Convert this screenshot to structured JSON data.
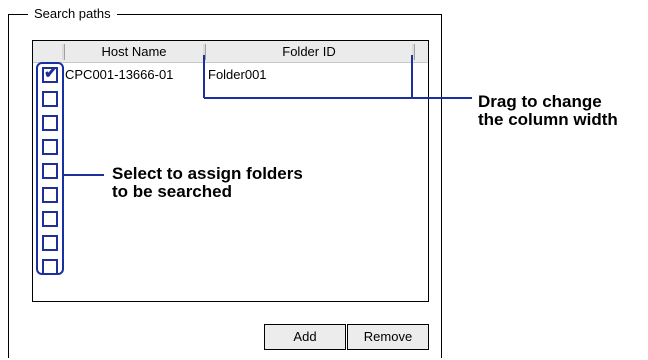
{
  "groupbox": {
    "title": "Search paths"
  },
  "table": {
    "columns": [
      "",
      "Host Name",
      "Folder ID"
    ],
    "rows": [
      {
        "checked": true,
        "host": "CPC001-13666-01",
        "folder": "Folder001"
      },
      {
        "checked": false,
        "host": "",
        "folder": ""
      },
      {
        "checked": false,
        "host": "",
        "folder": ""
      },
      {
        "checked": false,
        "host": "",
        "folder": ""
      },
      {
        "checked": false,
        "host": "",
        "folder": ""
      },
      {
        "checked": false,
        "host": "",
        "folder": ""
      },
      {
        "checked": false,
        "host": "",
        "folder": ""
      },
      {
        "checked": false,
        "host": "",
        "folder": ""
      },
      {
        "checked": false,
        "host": "",
        "folder": ""
      }
    ]
  },
  "buttons": {
    "add": "Add",
    "remove": "Remove"
  },
  "annotations": {
    "column_width_line1": "Drag to change",
    "column_width_line2": "the column width",
    "assign_line1": "Select to assign folders",
    "assign_line2": "to be searched"
  },
  "colors": {
    "annotation_line": "#1a2fa0",
    "checkbox_border": "#1f2f9a"
  }
}
